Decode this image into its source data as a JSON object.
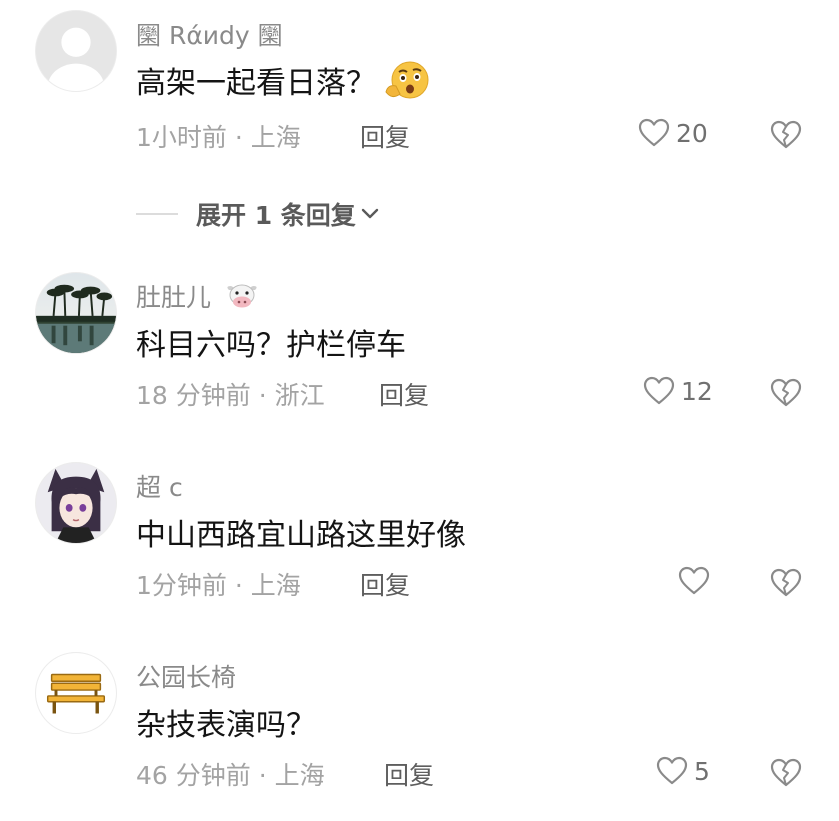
{
  "comments": [
    {
      "name": "圞 Rάиdy 圞",
      "text": "高架一起看日落？",
      "emoji": "thinking-face-emoji",
      "time_location": "1小时前 · 上海",
      "reply_label": "回复",
      "likes": "20"
    },
    {
      "name": "肚肚儿",
      "name_emoji": "cow-face-emoji",
      "text": "科目六吗？护栏停车",
      "time_location": "18 分钟前 · 浙江",
      "reply_label": "回复",
      "likes": "12"
    },
    {
      "name": "超 c",
      "text": "中山西路宜山路这里好像",
      "time_location": "1分钟前 · 上海",
      "reply_label": "回复",
      "likes": ""
    },
    {
      "name": "公园长椅",
      "text": "杂技表演吗？",
      "time_location": "46 分钟前 · 上海",
      "reply_label": "回复",
      "likes": "5"
    }
  ],
  "expand_replies": {
    "label": "展开 1 条回复"
  },
  "icons": {
    "like": "heart-outline-icon",
    "dislike": "broken-heart-icon",
    "expand": "chevron-down-icon"
  }
}
